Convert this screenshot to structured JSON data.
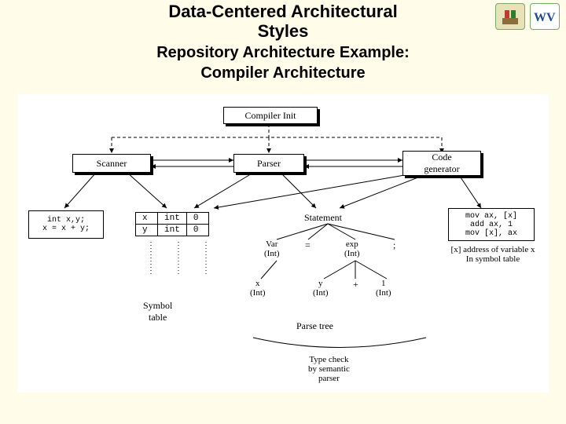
{
  "header": {
    "title_l1": "Data-Centered Architectural",
    "title_l2": "Styles",
    "subtitle_l1": "Repository Architecture Example:",
    "subtitle_l2": "Compiler Architecture"
  },
  "logos": {
    "a_alt": "university-seal",
    "b_alt": "WV"
  },
  "boxes": {
    "compiler_init": "Compiler Init",
    "scanner": "Scanner",
    "parser": "Parser",
    "codegen": "Code\ngenerator",
    "source": "int x,y;\nx = x + y;",
    "object": "mov ax, [x]\nadd ax, 1\nmov [x], ax"
  },
  "labels": {
    "object_note": "[x] address of variable x\nIn symbol table",
    "symbol_table": "Symbol\ntable",
    "parse_tree": "Parse tree",
    "type_check": "Type check\nby semantic\nparser",
    "stmt": "Statement",
    "var": "Var\n(Int)",
    "assign": "=",
    "exp": "exp\n(Int)",
    "semi": ";",
    "x1": "x\n(Int)",
    "y1": "y\n(Int)",
    "plus": "+",
    "one": "1\n(Int)"
  },
  "symtab": {
    "rows": [
      {
        "name": "x",
        "type": "int",
        "val": "0"
      },
      {
        "name": "y",
        "type": "int",
        "val": "0"
      }
    ]
  }
}
